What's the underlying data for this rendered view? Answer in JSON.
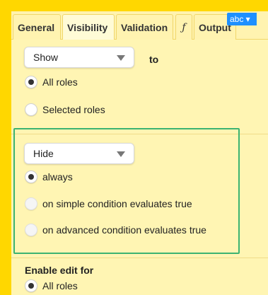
{
  "tabs": [
    {
      "label": "General",
      "active": false
    },
    {
      "label": "Visibility",
      "active": true
    },
    {
      "label": "Validation",
      "active": false
    },
    {
      "label": "ƒ",
      "active": false
    },
    {
      "label": "Output",
      "active": false
    }
  ],
  "abc_dropdown": {
    "label": "abc ▾"
  },
  "show_section": {
    "select_value": "Show",
    "to_label": "to",
    "options": [
      {
        "label": "All roles",
        "checked": true
      },
      {
        "label": "Selected roles",
        "checked": false
      }
    ]
  },
  "hide_section": {
    "select_value": "Hide",
    "options": [
      {
        "label": "always",
        "checked": true
      },
      {
        "label": "on simple condition evaluates true",
        "checked": false
      },
      {
        "label": "on advanced condition evaluates true",
        "checked": false
      }
    ]
  },
  "enable_edit": {
    "label": "Enable edit for",
    "options": [
      {
        "label": "All roles",
        "checked": true
      }
    ]
  },
  "colors": {
    "frame": "#ffd700",
    "panel": "#fff5b3",
    "highlight": "#3cb371",
    "accent": "#1e90ff"
  }
}
